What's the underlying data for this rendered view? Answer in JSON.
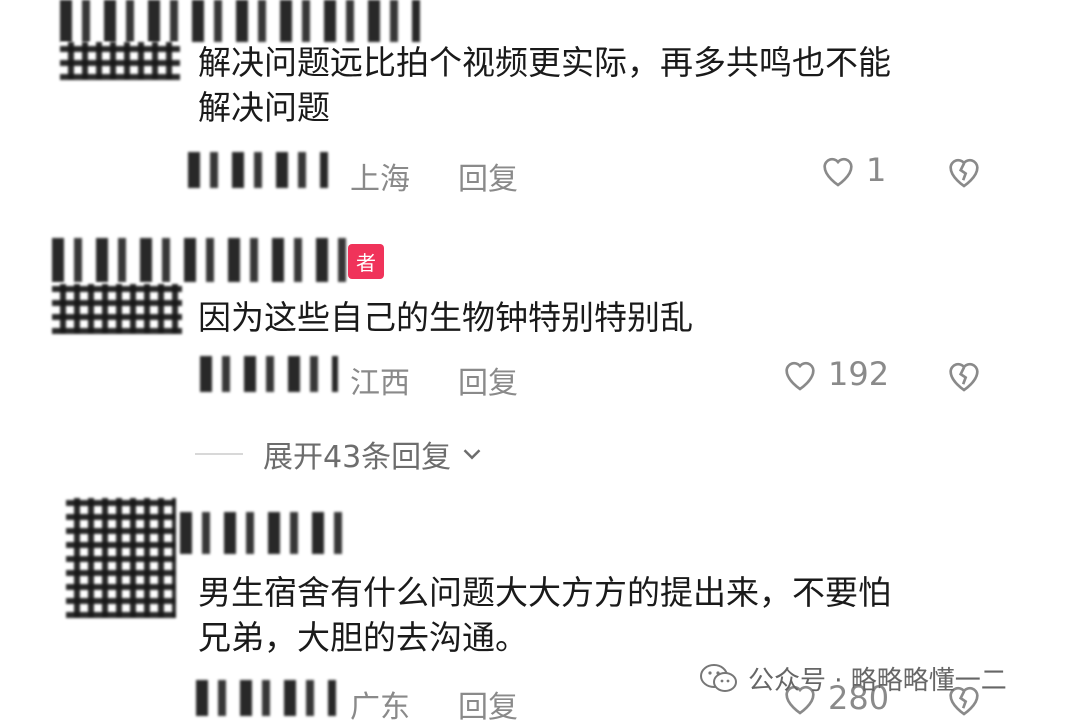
{
  "comments": [
    {
      "text_lines": [
        "解决问题远比拍个视频更实际，再多共鸣也不能",
        "解决问题"
      ],
      "location": "上海",
      "reply_label": "回复",
      "likes": "1"
    },
    {
      "author_badge": "者",
      "text_lines": [
        "因为这些自己的生物钟特别特别乱"
      ],
      "location": "江西",
      "reply_label": "回复",
      "likes": "192",
      "expand_label": "展开43条回复"
    },
    {
      "text_lines": [
        "男生宿舍有什么问题大大方方的提出来，不要怕",
        "兄弟，大胆的去沟通。"
      ],
      "location": "广东",
      "reply_label": "回复",
      "likes": "280"
    }
  ],
  "watermark": {
    "icon": "wechat-icon",
    "text": "公众号 · 略略略懂一二"
  },
  "colors": {
    "muted": "#8a8a8a",
    "badge": "#f0335a"
  }
}
